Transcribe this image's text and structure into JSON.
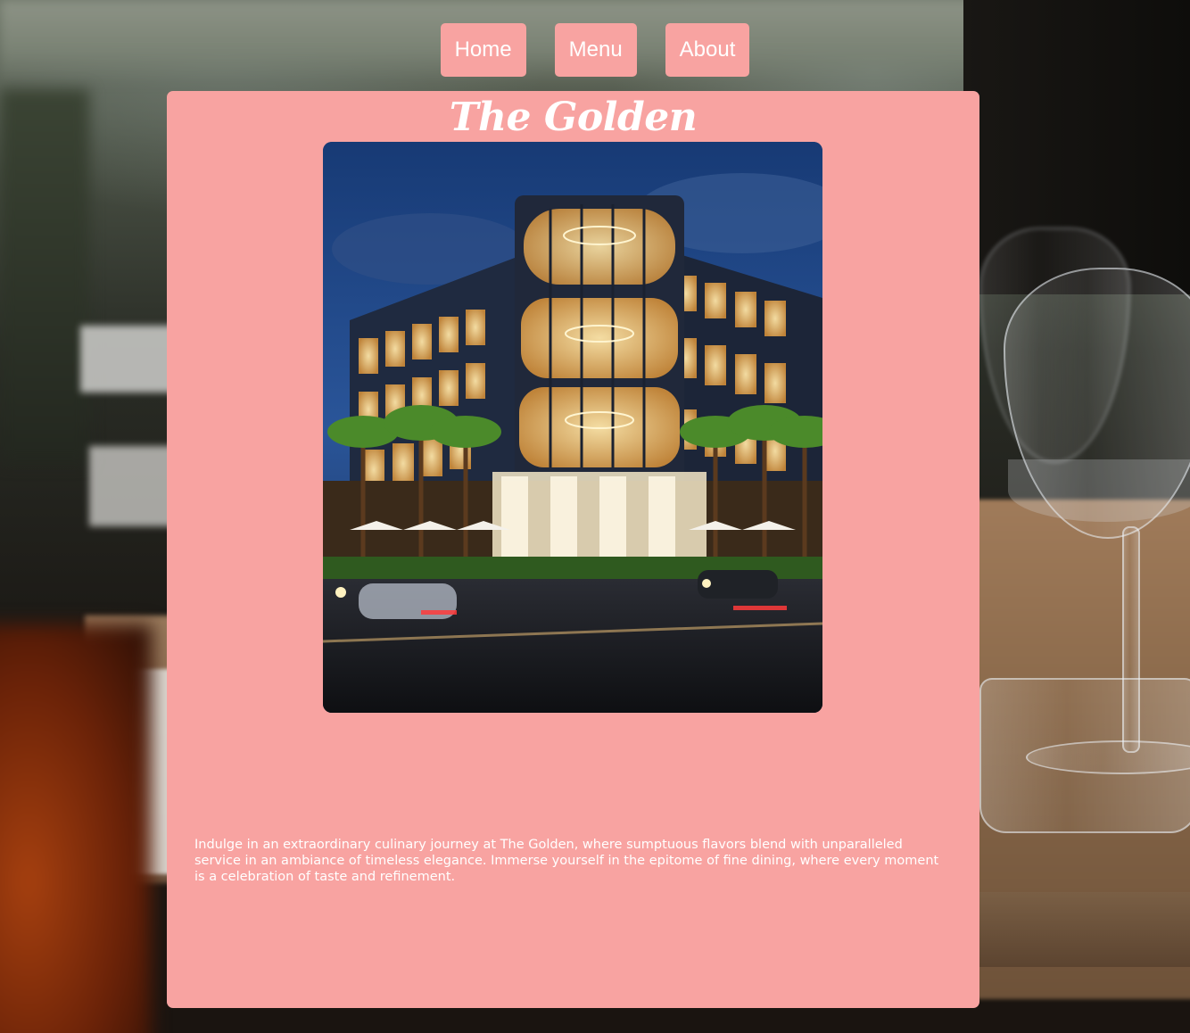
{
  "nav": {
    "items": [
      {
        "label": "Home"
      },
      {
        "label": "Menu"
      },
      {
        "label": "About"
      }
    ]
  },
  "main": {
    "title": "The Golden",
    "hero_image": "restaurant-building-night",
    "description": "Indulge in an extraordinary culinary journey at The Golden, where sumptuous flavors blend with unparalleled service in an ambiance of timeless elegance. Immerse yourself in the epitome of fine dining, where every moment is a celebration of taste and refinement."
  },
  "colors": {
    "card": "#f8a3a1",
    "text": "#ffffff"
  }
}
